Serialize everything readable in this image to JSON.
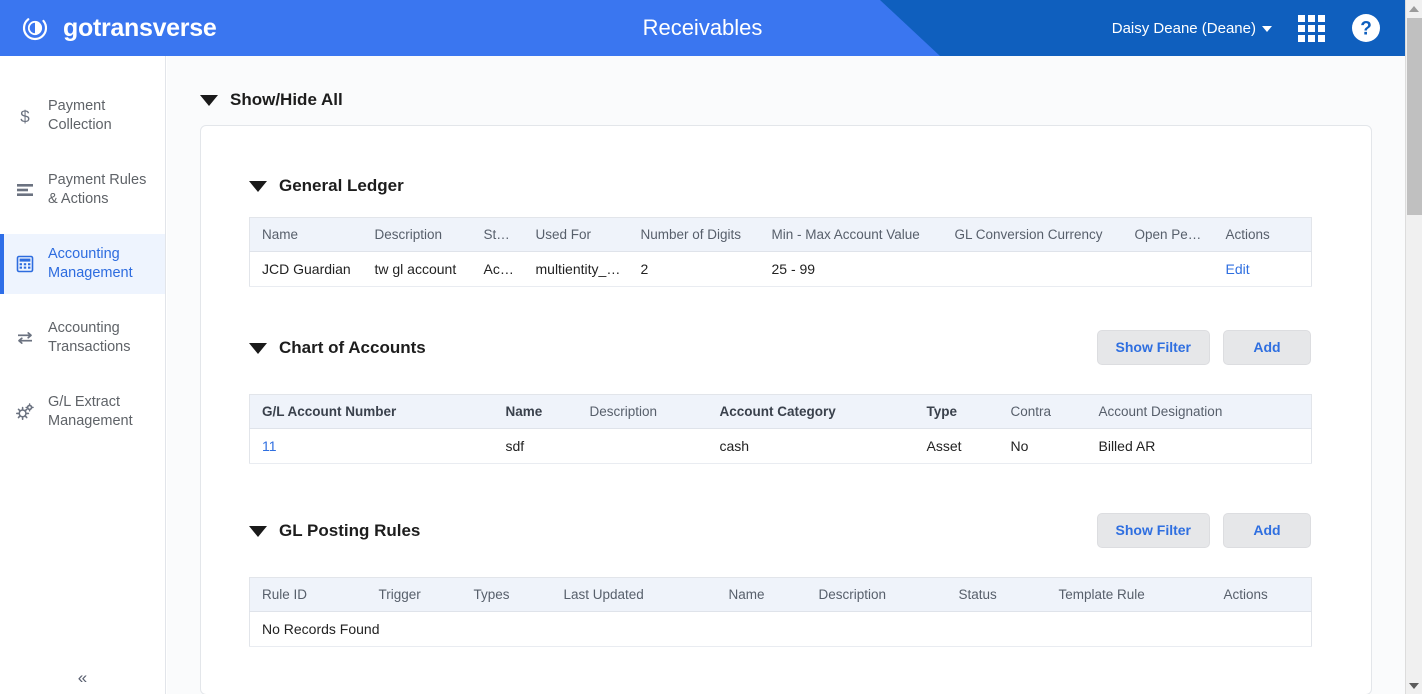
{
  "header": {
    "brand": "gotransverse",
    "brand_logo_icon": "circle-swoosh-logo",
    "title": "Receivables",
    "user_menu": "Daisy Deane (Deane)",
    "apps_icon": "grid-apps-icon",
    "help_icon": "help-question-icon",
    "bg_color": "#0f5fbe",
    "accent_color": "#3a76f0"
  },
  "sidebar": {
    "collapse_label": "«",
    "items": [
      {
        "label": "Payment Collection",
        "icon": "dollar-sign-icon",
        "active": false
      },
      {
        "label": "Payment Rules & Actions",
        "icon": "rules-lines-icon",
        "active": false
      },
      {
        "label": "Accounting Management",
        "icon": "calculator-icon",
        "active": true
      },
      {
        "label": "Accounting Transactions",
        "icon": "exchange-arrows-icon",
        "active": false
      },
      {
        "label": "G/L Extract Management",
        "icon": "gears-icon",
        "active": false
      }
    ],
    "active_color": "#2d6cdf"
  },
  "content": {
    "show_hide_all": "Show/Hide All",
    "sections": {
      "general_ledger": {
        "title": "General Ledger",
        "columns": [
          "Name",
          "Description",
          "Status",
          "Used For",
          "Number of Digits",
          "Min - Max Account Value",
          "GL Conversion Currency",
          "Open Period",
          "Actions"
        ],
        "rows": [
          {
            "name": "JCD Guardian",
            "description": "tw gl account",
            "status": "Active",
            "used_for": "multientity_qa",
            "number_of_digits": "2",
            "min_max_account_value": "25 - 99",
            "gl_conversion_currency": "",
            "open_period": "",
            "actions": "Edit"
          }
        ]
      },
      "chart_of_accounts": {
        "title": "Chart of Accounts",
        "show_filter_label": "Show Filter",
        "add_label": "Add",
        "columns": [
          "G/L Account Number",
          "Name",
          "Description",
          "Account Category",
          "Type",
          "Contra",
          "Account Designation"
        ],
        "rows": [
          {
            "gl_account_number": "11",
            "name": "sdf",
            "description": "",
            "account_category": "cash",
            "type": "Asset",
            "contra": "No",
            "account_designation": "Billed AR"
          }
        ]
      },
      "gl_posting_rules": {
        "title": "GL Posting Rules",
        "show_filter_label": "Show Filter",
        "add_label": "Add",
        "columns": [
          "Rule ID",
          "Trigger",
          "Types",
          "Last Updated",
          "Name",
          "Description",
          "Status",
          "Template Rule",
          "Actions"
        ],
        "empty_message": "No Records Found"
      }
    }
  },
  "scrollbar": {
    "up_arrow_icon": "scroll-up-arrow-icon",
    "down_arrow_icon": "scroll-down-arrow-icon"
  }
}
